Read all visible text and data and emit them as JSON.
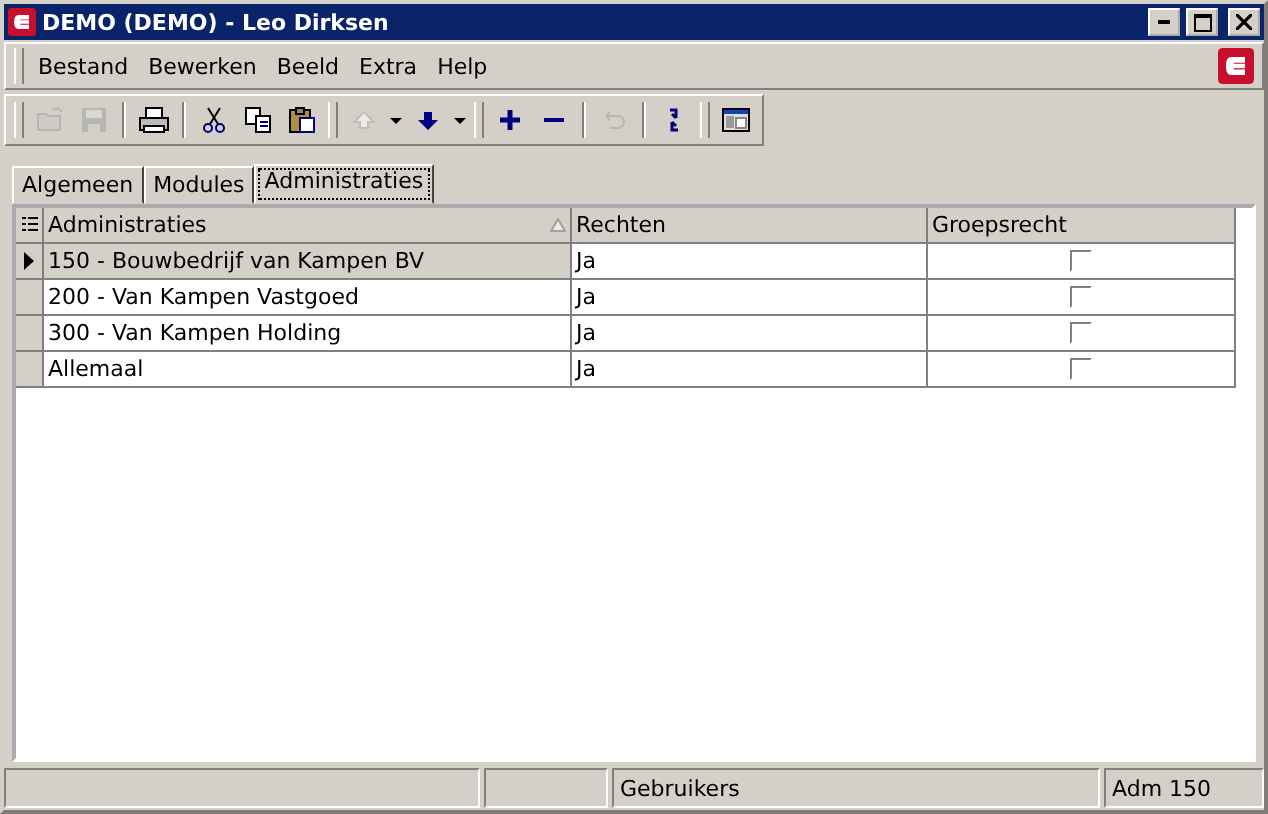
{
  "window": {
    "title": "DEMO (DEMO) - Leo Dirksen"
  },
  "menu": [
    "Bestand",
    "Bewerken",
    "Beeld",
    "Extra",
    "Help"
  ],
  "toolbar": [
    {
      "kind": "open",
      "disabled": true
    },
    {
      "kind": "save",
      "disabled": true
    },
    {
      "kind": "separator"
    },
    {
      "kind": "print",
      "disabled": false
    },
    {
      "kind": "separator"
    },
    {
      "kind": "cut",
      "disabled": false
    },
    {
      "kind": "copy",
      "disabled": false
    },
    {
      "kind": "paste",
      "disabled": false
    },
    {
      "kind": "grip"
    },
    {
      "kind": "up",
      "disabled": true
    },
    {
      "kind": "caret",
      "disabled": false
    },
    {
      "kind": "down",
      "disabled": false
    },
    {
      "kind": "caret",
      "disabled": false
    },
    {
      "kind": "grip"
    },
    {
      "kind": "add",
      "disabled": false
    },
    {
      "kind": "remove",
      "disabled": false
    },
    {
      "kind": "separator"
    },
    {
      "kind": "undo",
      "disabled": true
    },
    {
      "kind": "separator"
    },
    {
      "kind": "refresh",
      "disabled": false
    },
    {
      "kind": "grip"
    },
    {
      "kind": "layout",
      "disabled": false
    }
  ],
  "tabs": [
    {
      "label": "Algemeen",
      "selected": false
    },
    {
      "label": "Modules",
      "selected": false
    },
    {
      "label": "Administraties",
      "selected": true
    }
  ],
  "table": {
    "columns": [
      {
        "label": "Administraties",
        "sorted": true
      },
      {
        "label": "Rechten",
        "sorted": false
      },
      {
        "label": "Groepsrecht",
        "sorted": false
      }
    ],
    "rows": [
      {
        "administratie": "150 - Bouwbedrijf van Kampen BV",
        "rechten": "Ja",
        "groepsrecht": false,
        "selected": true
      },
      {
        "administratie": "200 - Van Kampen Vastgoed",
        "rechten": "Ja",
        "groepsrecht": false,
        "selected": false
      },
      {
        "administratie": "300 - Van Kampen Holding",
        "rechten": "Ja",
        "groepsrecht": false,
        "selected": false
      },
      {
        "administratie": "Allemaal",
        "rechten": "Ja",
        "groepsrecht": false,
        "selected": false
      }
    ]
  },
  "status_bar": [
    "Gebruikers",
    "Adm 150"
  ]
}
